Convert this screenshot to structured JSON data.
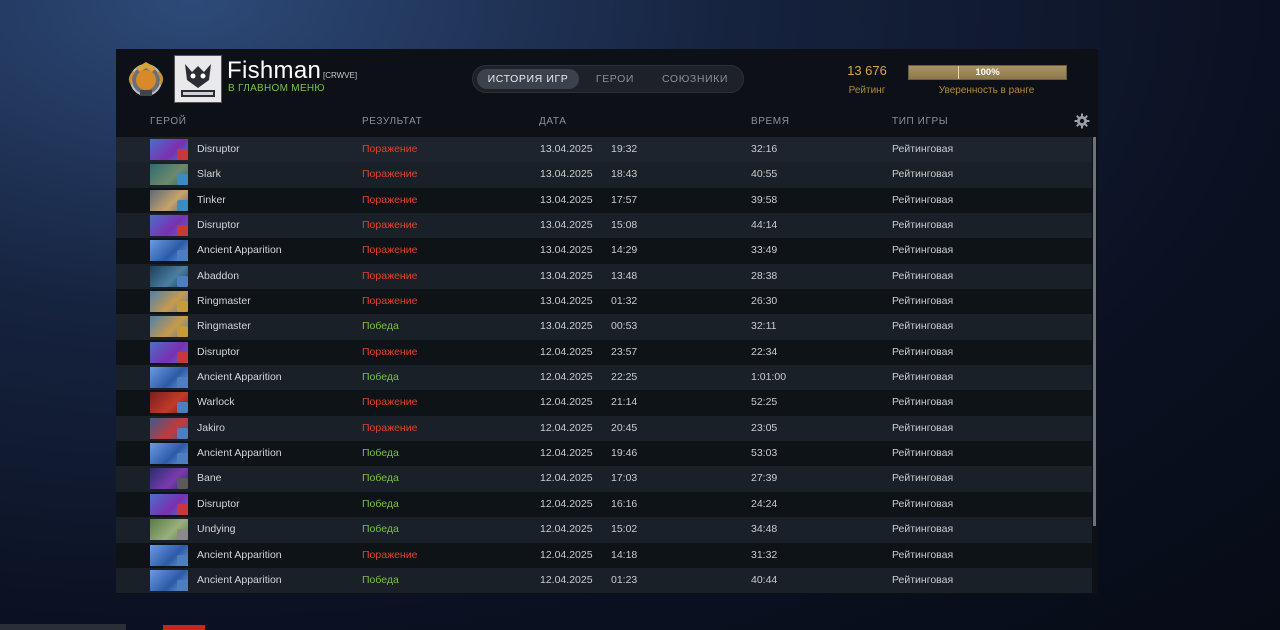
{
  "header": {
    "player_name": "Fishman",
    "player_tag": "[CRWVE]",
    "player_status": "В ГЛАВНОМ МЕНЮ",
    "rank_medal_icon": "rank-medal-icon",
    "avatar_icon": "team-logo-avatar"
  },
  "tabs": [
    {
      "label": "ИСТОРИЯ ИГР",
      "active": true
    },
    {
      "label": "ГЕРОИ",
      "active": false
    },
    {
      "label": "СОЮЗНИКИ",
      "active": false
    }
  ],
  "rating": {
    "value": "13 676",
    "label": "Рейтинг",
    "confidence_text": "100%",
    "confidence_fraction": 1.0,
    "confidence_label": "Уверенность в ранге"
  },
  "columns": {
    "hero": "ГЕРОЙ",
    "result": "РЕЗУЛЬТАТ",
    "date": "ДАТА",
    "duration": "ВРЕМЯ",
    "game_type": "ТИП ИГРЫ"
  },
  "colors": {
    "loss": "#e0412f",
    "win": "#78c142",
    "rating_gold": "#d7a847",
    "status_green": "#79c24a"
  },
  "matches": [
    {
      "hero": "Disruptor",
      "result": "Поражение",
      "outcome": "loss",
      "date": "13.04.2025",
      "time": "19:32",
      "duration": "32:16",
      "type": "Рейтинговая"
    },
    {
      "hero": "Slark",
      "result": "Поражение",
      "outcome": "loss",
      "date": "13.04.2025",
      "time": "18:43",
      "duration": "40:55",
      "type": "Рейтинговая"
    },
    {
      "hero": "Tinker",
      "result": "Поражение",
      "outcome": "loss",
      "date": "13.04.2025",
      "time": "17:57",
      "duration": "39:58",
      "type": "Рейтинговая"
    },
    {
      "hero": "Disruptor",
      "result": "Поражение",
      "outcome": "loss",
      "date": "13.04.2025",
      "time": "15:08",
      "duration": "44:14",
      "type": "Рейтинговая"
    },
    {
      "hero": "Ancient Apparition",
      "result": "Поражение",
      "outcome": "loss",
      "date": "13.04.2025",
      "time": "14:29",
      "duration": "33:49",
      "type": "Рейтинговая"
    },
    {
      "hero": "Abaddon",
      "result": "Поражение",
      "outcome": "loss",
      "date": "13.04.2025",
      "time": "13:48",
      "duration": "28:38",
      "type": "Рейтинговая"
    },
    {
      "hero": "Ringmaster",
      "result": "Поражение",
      "outcome": "loss",
      "date": "13.04.2025",
      "time": "01:32",
      "duration": "26:30",
      "type": "Рейтинговая"
    },
    {
      "hero": "Ringmaster",
      "result": "Победа",
      "outcome": "win",
      "date": "13.04.2025",
      "time": "00:53",
      "duration": "32:11",
      "type": "Рейтинговая"
    },
    {
      "hero": "Disruptor",
      "result": "Поражение",
      "outcome": "loss",
      "date": "12.04.2025",
      "time": "23:57",
      "duration": "22:34",
      "type": "Рейтинговая"
    },
    {
      "hero": "Ancient Apparition",
      "result": "Победа",
      "outcome": "win",
      "date": "12.04.2025",
      "time": "22:25",
      "duration": "1:01:00",
      "type": "Рейтинговая"
    },
    {
      "hero": "Warlock",
      "result": "Поражение",
      "outcome": "loss",
      "date": "12.04.2025",
      "time": "21:14",
      "duration": "52:25",
      "type": "Рейтинговая"
    },
    {
      "hero": "Jakiro",
      "result": "Поражение",
      "outcome": "loss",
      "date": "12.04.2025",
      "time": "20:45",
      "duration": "23:05",
      "type": "Рейтинговая"
    },
    {
      "hero": "Ancient Apparition",
      "result": "Победа",
      "outcome": "win",
      "date": "12.04.2025",
      "time": "19:46",
      "duration": "53:03",
      "type": "Рейтинговая"
    },
    {
      "hero": "Bane",
      "result": "Победа",
      "outcome": "win",
      "date": "12.04.2025",
      "time": "17:03",
      "duration": "27:39",
      "type": "Рейтинговая"
    },
    {
      "hero": "Disruptor",
      "result": "Победа",
      "outcome": "win",
      "date": "12.04.2025",
      "time": "16:16",
      "duration": "24:24",
      "type": "Рейтинговая"
    },
    {
      "hero": "Undying",
      "result": "Победа",
      "outcome": "win",
      "date": "12.04.2025",
      "time": "15:02",
      "duration": "34:48",
      "type": "Рейтинговая"
    },
    {
      "hero": "Ancient Apparition",
      "result": "Поражение",
      "outcome": "loss",
      "date": "12.04.2025",
      "time": "14:18",
      "duration": "31:32",
      "type": "Рейтинговая"
    },
    {
      "hero": "Ancient Apparition",
      "result": "Победа",
      "outcome": "win",
      "date": "12.04.2025",
      "time": "01:23",
      "duration": "40:44",
      "type": "Рейтинговая"
    }
  ]
}
